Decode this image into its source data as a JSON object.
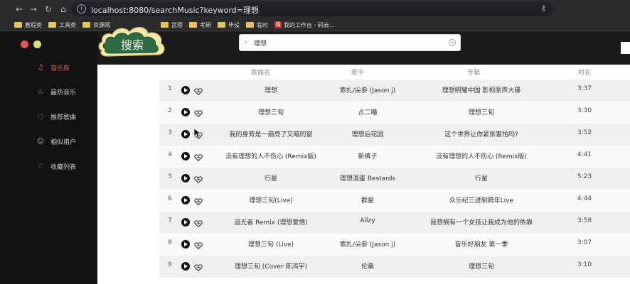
{
  "browser": {
    "url": "localhost:8080/searchMusic?keyword=理想",
    "bookmarks": [
      "教程类",
      "工具类",
      "资源网",
      "武理",
      "考研",
      "毕设",
      "临时",
      "我的工作台 - 码云..."
    ]
  },
  "sidebar": {
    "items": [
      {
        "label": "音乐库",
        "icon": "music-icon",
        "active": true
      },
      {
        "label": "最热音乐",
        "icon": "fire-icon",
        "active": false
      },
      {
        "label": "推荐歌曲",
        "icon": "chat-icon",
        "active": false
      },
      {
        "label": "相似用户",
        "icon": "user-icon",
        "active": false
      },
      {
        "label": "收藏列表",
        "icon": "heart-icon",
        "active": false
      }
    ]
  },
  "logo": {
    "text": "搜索"
  },
  "search": {
    "value": "理想"
  },
  "table": {
    "headers": [
      "歌曲名",
      "歌手",
      "专辑",
      "时长"
    ],
    "rows": [
      {
        "num": "1",
        "title": "理想",
        "artist": "索扎/尖参 (Jason j)",
        "album": "理想照耀中国 影视原声大碟",
        "duration": "3:37"
      },
      {
        "num": "2",
        "title": "理想三旬",
        "artist": "占二曦",
        "album": "理想三旬",
        "duration": "3:30"
      },
      {
        "num": "3",
        "title": "我的身旁是一扇亮了又暗的窗",
        "artist": "理想后花园",
        "album": "这个世界让你紧张害怕吗?",
        "duration": "3:52"
      },
      {
        "num": "4",
        "title": "没有理想的人不伤心 (Remix版)",
        "artist": "新裤子",
        "album": "没有理想的人不伤心 (Remix版)",
        "duration": "4:41"
      },
      {
        "num": "5",
        "title": "行星",
        "artist": "理想混蛋 Bestards",
        "album": "行星",
        "duration": "5:23"
      },
      {
        "num": "6",
        "title": "理想三旬(Live)",
        "artist": "群星",
        "album": "众乐纪三进制跨年Live",
        "duration": "4:44"
      },
      {
        "num": "7",
        "title": "追光者 Remix (理想爱情)",
        "artist": "Allzy",
        "album": "我想拥有一个女孩让我成为他的依靠",
        "duration": "3:58"
      },
      {
        "num": "8",
        "title": "理想三旬 (Live)",
        "artist": "索扎/尖参 (Jason j)",
        "album": "音乐好朋友 第一季",
        "duration": "3:07"
      },
      {
        "num": "9",
        "title": "理想三旬 (Cover 陈鸿宇)",
        "artist": "伦桑",
        "album": "理想三旬",
        "duration": "3:10"
      }
    ]
  },
  "colors": {
    "accent": "#e45f5f",
    "logo_board": "#2e6b45"
  }
}
